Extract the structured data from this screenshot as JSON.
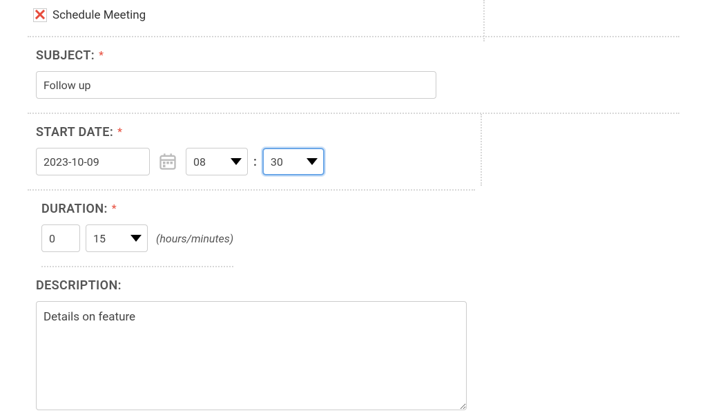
{
  "header": {
    "title": "Schedule Meeting"
  },
  "subject": {
    "label": "SUBJECT:",
    "value": "Follow up"
  },
  "start_date": {
    "label": "START DATE:",
    "date": "2023-10-09",
    "hour": "08",
    "minute": "30"
  },
  "duration": {
    "label": "DURATION:",
    "hours": "0",
    "minutes": "15",
    "unit": "(hours/minutes)"
  },
  "description": {
    "label": "DESCRIPTION:",
    "value": "Details on feature"
  },
  "symbols": {
    "required": "*",
    "colon": ":"
  }
}
